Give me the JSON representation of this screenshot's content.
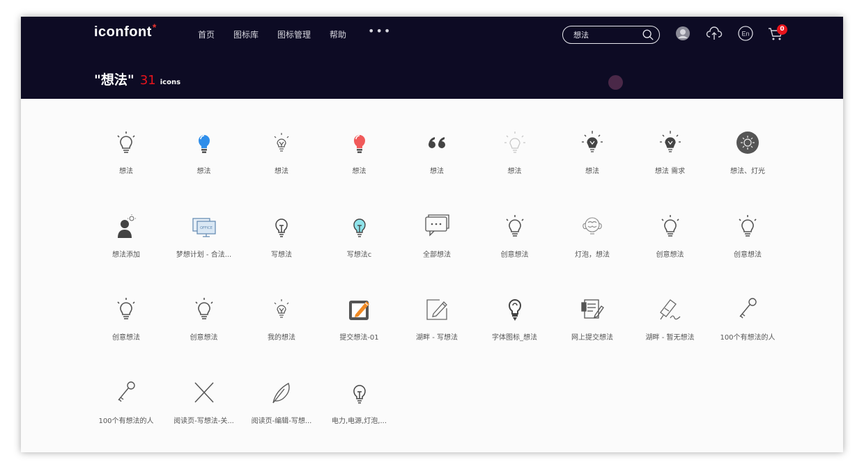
{
  "header": {
    "logo": "iconfont",
    "logo_mark": "*",
    "nav": [
      "首页",
      "图标库",
      "图标管理",
      "帮助"
    ],
    "more": "•••",
    "search": {
      "value": "想法"
    },
    "icons": [
      "search-icon",
      "avatar-icon",
      "upload-icon",
      "language-icon",
      "cart-icon"
    ],
    "lang": "En",
    "cart_count": "0",
    "bg_color": "#0d0b24",
    "accent": "#e8141c"
  },
  "result": {
    "query": "\"想法\"",
    "count": "31",
    "unit": "icons"
  },
  "icons": [
    {
      "label": "想法",
      "icon": "bulb-outline"
    },
    {
      "label": "想法",
      "icon": "bulb-blue"
    },
    {
      "label": "想法",
      "icon": "bulb-thin"
    },
    {
      "label": "想法",
      "icon": "bulb-red"
    },
    {
      "label": "想法",
      "icon": "quote"
    },
    {
      "label": "想法",
      "icon": "bulb-light"
    },
    {
      "label": "想法",
      "icon": "bulb-dark"
    },
    {
      "label": "想法 需求",
      "icon": "bulb-dark"
    },
    {
      "label": "想法、灯光",
      "icon": "bulb-circle"
    },
    {
      "label": "想法添加",
      "icon": "person-idea"
    },
    {
      "label": "梦想计划 - 合法...",
      "icon": "screens"
    },
    {
      "label": "写想法",
      "icon": "bulb-simple"
    },
    {
      "label": "写想法c",
      "icon": "bulb-cyan"
    },
    {
      "label": "全部想法",
      "icon": "chat-box"
    },
    {
      "label": "创意想法",
      "icon": "bulb-outline"
    },
    {
      "label": "灯泡，想法",
      "icon": "brain-bulb"
    },
    {
      "label": "创意想法",
      "icon": "bulb-outline"
    },
    {
      "label": "创意想法",
      "icon": "bulb-outline"
    },
    {
      "label": "创意想法",
      "icon": "bulb-outline"
    },
    {
      "label": "创意想法",
      "icon": "bulb-outline"
    },
    {
      "label": "我的想法",
      "icon": "bulb-thin"
    },
    {
      "label": "提交想法-01",
      "icon": "edit-orange"
    },
    {
      "label": "湖畔 - 写想法",
      "icon": "edit-square"
    },
    {
      "label": "字体图标_想法",
      "icon": "bulb-pin"
    },
    {
      "label": "网上提交想法",
      "icon": "doc-write"
    },
    {
      "label": "湖畔 - 暂无想法",
      "icon": "pen-sign"
    },
    {
      "label": "100个有想法的人",
      "icon": "key"
    },
    {
      "label": "100个有想法的人",
      "icon": "key"
    },
    {
      "label": "阅读页-写想法-关...",
      "icon": "close-x"
    },
    {
      "label": "阅读页-编辑-写想...",
      "icon": "feather"
    },
    {
      "label": "电力,电源,灯泡,...",
      "icon": "bulb-simple"
    }
  ]
}
